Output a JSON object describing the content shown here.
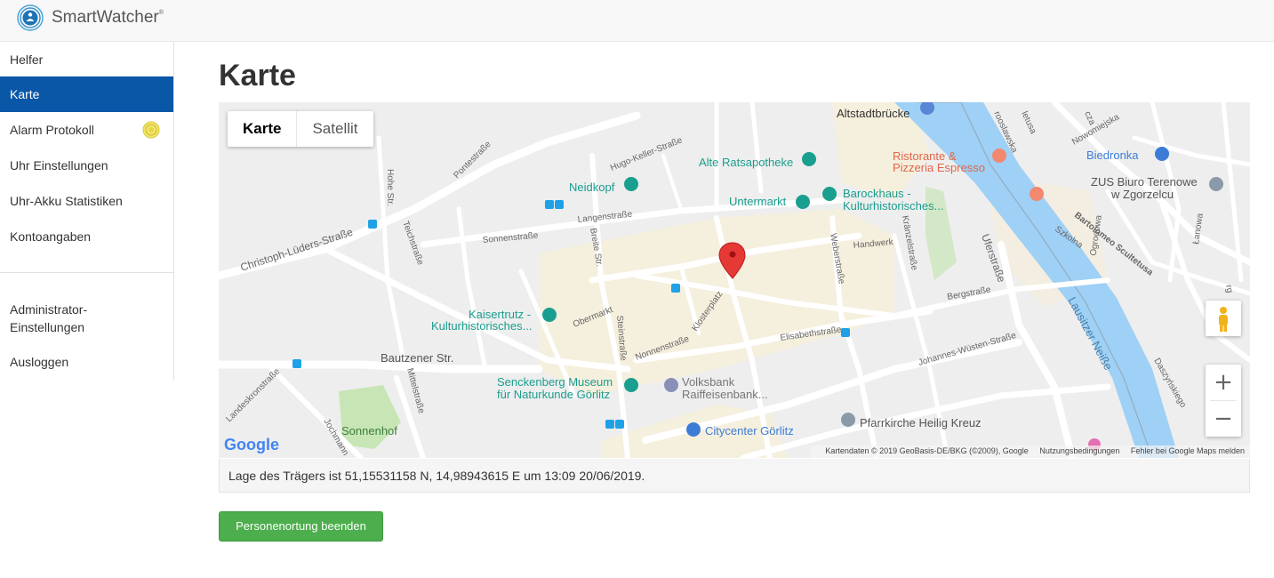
{
  "app": {
    "brand": "SmartWatcher",
    "brand_mark": "®"
  },
  "sidebar": {
    "items": [
      {
        "label": "Helfer"
      },
      {
        "label": "Karte",
        "active": true
      },
      {
        "label": "Alarm Protokoll"
      },
      {
        "label": "Uhr Einstellungen"
      },
      {
        "label": "Uhr-Akku Statistiken"
      },
      {
        "label": "Kontoangaben"
      },
      {
        "label": "Administrator-Einstellungen"
      },
      {
        "label": "Ausloggen"
      }
    ],
    "admin_line1": "Administrator-",
    "admin_line2": "Einstellungen",
    "active_color": "#0a57a7"
  },
  "main": {
    "title": "Karte"
  },
  "map": {
    "type_buttons": [
      "Karte",
      "Satellit"
    ],
    "selected_type": "Karte",
    "places": {
      "altstadtbruecke": "Altstadtbrücke",
      "alte_ratsapotheke": "Alte Ratsapotheke",
      "ristorante1": "Ristorante &",
      "ristorante2": "Pizzeria Espresso",
      "biedronka": "Biedronka",
      "zus1": "ZUS Biuro Terenowe",
      "zus2": "w Zgorzelcu",
      "neidkopf": "Neidkopf",
      "untermarkt": "Untermarkt",
      "barockhaus1": "Barockhaus -",
      "barockhaus2": "Kulturhistorisches...",
      "kaisertrutz1": "Kaisertrutz -",
      "kaisertrutz2": "Kulturhistorisches...",
      "senckenberg1": "Senckenberg Museum",
      "senckenberg2": "für Naturkunde Görlitz",
      "volksbank1": "Volksbank",
      "volksbank2": "Raiffeisenbank...",
      "citycenter": "Citycenter Görlitz",
      "pfarrkirche": "Pfarrkirche Heilig Kreuz",
      "sonnenhof": "Sonnenhof"
    },
    "streets": {
      "hugo": "Hugo-Keller-Straße",
      "pontestr": "Pontestraße",
      "hohe": "Hohe Str.",
      "christoph": "Christoph-Lüders-Straße",
      "teichstr": "Teichstraße",
      "sonnenstr": "Sonnenstraße",
      "langenstr": "Langenstraße",
      "breite": "Breite Str.",
      "obermarkt": "Obermarkt",
      "steinstr": "Steinstraße",
      "nonnenstr": "Nonnenstraße",
      "klosterplatz": "Klosterplatz",
      "bautzener": "Bautzener Str.",
      "mittelstr": "Mittelstraße",
      "landeskron": "Landeskronstraße",
      "jochmann": "Jochmann",
      "elisabeth": "Elisabethstraße",
      "johannes": "Johannes-Wüsten-Straße",
      "bergstr": "Bergstraße",
      "handwerk": "Handwerk",
      "weberstr": "Weberstraße",
      "kraenzel": "Kränzelstraße",
      "uferstr": "Uferstraße",
      "lausitzer": "Lausitzer Neiße",
      "szkolna": "Szkolna",
      "bartolomeo": "Bartolomeo Scultetusa",
      "ogrodowa": "Ogrodowa",
      "lanowa": "Łanowa",
      "daszynskiego": "Daszyńskiego",
      "nowomiejska": "Nowomiejska",
      "rooslawska": "rooslawska",
      "letusa": "letusa",
      "cza": "cza",
      "rg": "rg"
    },
    "google": "Google",
    "attribution": "Kartendaten © 2019 GeoBasis-DE/BKG (©2009), Google",
    "terms": "Nutzungsbedingungen",
    "report": "Fehler bei Google Maps melden",
    "zoom_in": "+",
    "zoom_out": "−",
    "pin_color": "#e53935",
    "water_color": "#9fd0f5"
  },
  "location": {
    "text": "Lage des Trägers ist 51,15531158 N, 14,98943615 E um 13:09 20/06/2019."
  },
  "actions": {
    "stop_label": "Personenortung beenden"
  }
}
